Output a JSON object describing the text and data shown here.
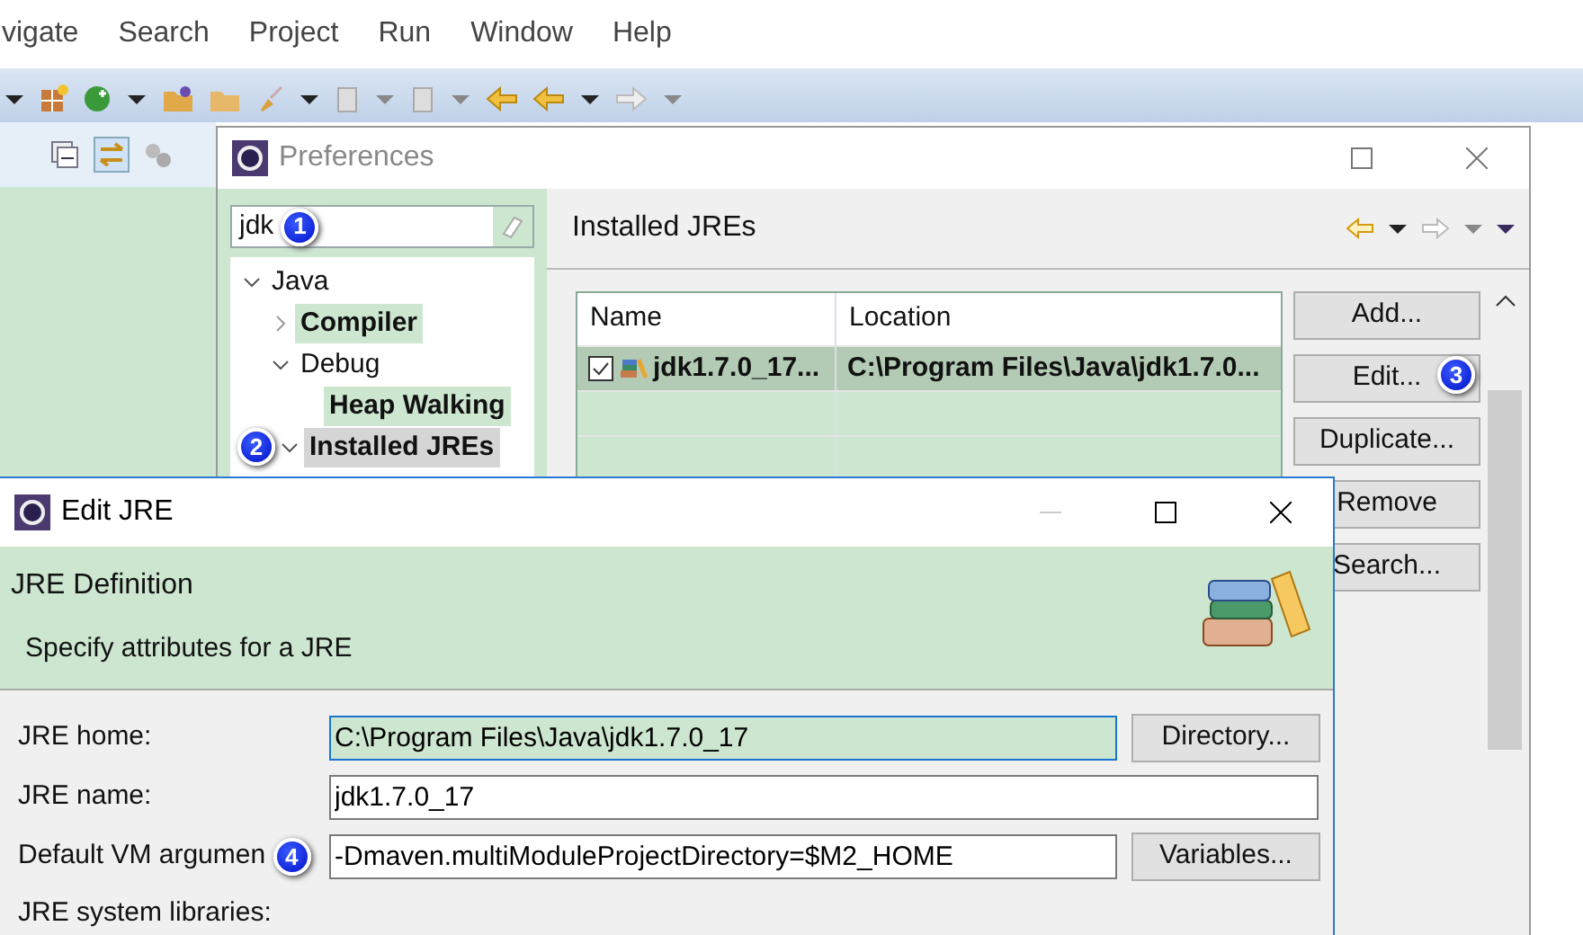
{
  "menu_bar": {
    "items": [
      "vigate",
      "Search",
      "Project",
      "Run",
      "Window",
      "Help"
    ]
  },
  "preferences": {
    "title": "Preferences",
    "active": false,
    "filter": {
      "value": "jdk",
      "callout": "1"
    },
    "tree": [
      {
        "label": "Java",
        "expanded": true,
        "matched": false,
        "selected": false,
        "children": [
          {
            "label": "Compiler",
            "expanded": false,
            "matched": true,
            "selected": false
          },
          {
            "label": "Debug",
            "expanded": true,
            "matched": false,
            "selected": false,
            "children": [
              {
                "label": "Heap Walking",
                "matched": true,
                "selected": false
              }
            ]
          },
          {
            "label": "Installed JREs",
            "expanded": true,
            "matched": true,
            "selected": true,
            "callout": "2"
          }
        ]
      }
    ],
    "page_title": "Installed JREs",
    "jre_table": {
      "columns": [
        "Name",
        "Location"
      ],
      "rows": [
        {
          "name": "jdk1.7.0_17...",
          "location": "C:\\Program Files\\Java\\jdk1.7.0...",
          "checked": true,
          "selected": true
        }
      ]
    },
    "buttons": [
      {
        "label": "Add..."
      },
      {
        "label": "Edit...",
        "callout": "3"
      },
      {
        "label": "Duplicate..."
      },
      {
        "label": "Remove"
      },
      {
        "label": "Search..."
      }
    ]
  },
  "edit_jre": {
    "title": "Edit JRE",
    "active": true,
    "heading": "JRE Definition",
    "description": "Specify attributes for a JRE",
    "fields": [
      {
        "label": "JRE home:",
        "value": "C:\\Program Files\\Java\\jdk1.7.0_17",
        "focused": true,
        "button": "Directory..."
      },
      {
        "label": "JRE name:",
        "value": "jdk1.7.0_17",
        "focused": false
      },
      {
        "label": "Default VM argumen",
        "value": "-Dmaven.multiModuleProjectDirectory=$M2_HOME",
        "focused": false,
        "button": "Variables...",
        "callout": "4"
      }
    ],
    "libraries_label": "JRE system libraries:"
  }
}
